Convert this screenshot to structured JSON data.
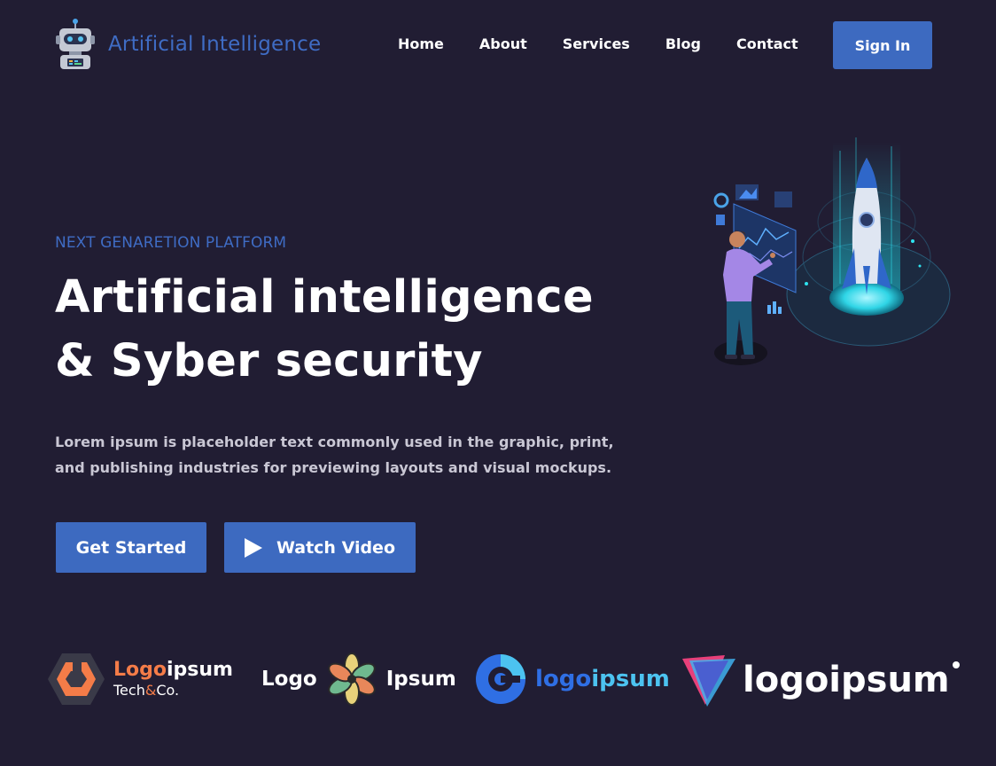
{
  "brand": {
    "name": "Artificial Intelligence",
    "icon": "robot-icon"
  },
  "nav": {
    "items": [
      "Home",
      "About",
      "Services",
      "Blog",
      "Contact"
    ]
  },
  "header": {
    "signin_label": "Sign In"
  },
  "hero": {
    "eyebrow": "NEXT GENARETION PLATFORM",
    "headline_line1": "Artificial intelligence",
    "headline_line2": "& Syber security",
    "description": "Lorem ipsum is placeholder text commonly used in the graphic, print, and publishing industries for previewing layouts and visual mockups.",
    "cta_primary": "Get Started",
    "cta_secondary": "Watch Video"
  },
  "partners": [
    {
      "strong": "Logo",
      "rest": "ipsum",
      "sub_a": "Tech",
      "sub_amp": "&",
      "sub_b": "Co."
    },
    {
      "left": "Logo",
      "right": "Ipsum"
    },
    {
      "a": "logo",
      "b": "ipsum"
    },
    {
      "text": "logoipsum"
    }
  ],
  "colors": {
    "background": "#211d33",
    "accent": "#3d6ac0",
    "brand_text": "#3f6cc4",
    "partner_orange": "#f47c48"
  }
}
